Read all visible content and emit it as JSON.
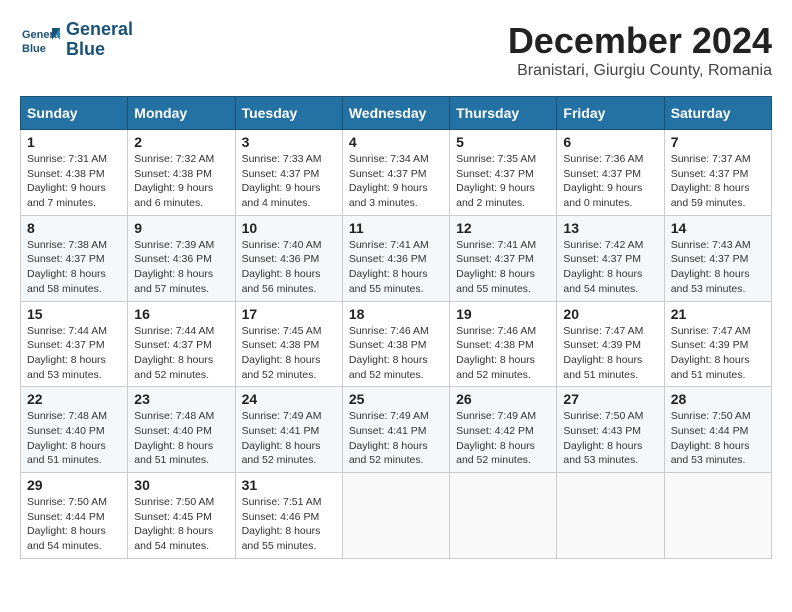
{
  "header": {
    "logo_line1": "General",
    "logo_line2": "Blue",
    "title": "December 2024",
    "subtitle": "Branistari, Giurgiu County, Romania"
  },
  "calendar": {
    "headers": [
      "Sunday",
      "Monday",
      "Tuesday",
      "Wednesday",
      "Thursday",
      "Friday",
      "Saturday"
    ],
    "weeks": [
      [
        {
          "day": "1",
          "info": "Sunrise: 7:31 AM\nSunset: 4:38 PM\nDaylight: 9 hours\nand 7 minutes."
        },
        {
          "day": "2",
          "info": "Sunrise: 7:32 AM\nSunset: 4:38 PM\nDaylight: 9 hours\nand 6 minutes."
        },
        {
          "day": "3",
          "info": "Sunrise: 7:33 AM\nSunset: 4:37 PM\nDaylight: 9 hours\nand 4 minutes."
        },
        {
          "day": "4",
          "info": "Sunrise: 7:34 AM\nSunset: 4:37 PM\nDaylight: 9 hours\nand 3 minutes."
        },
        {
          "day": "5",
          "info": "Sunrise: 7:35 AM\nSunset: 4:37 PM\nDaylight: 9 hours\nand 2 minutes."
        },
        {
          "day": "6",
          "info": "Sunrise: 7:36 AM\nSunset: 4:37 PM\nDaylight: 9 hours\nand 0 minutes."
        },
        {
          "day": "7",
          "info": "Sunrise: 7:37 AM\nSunset: 4:37 PM\nDaylight: 8 hours\nand 59 minutes."
        }
      ],
      [
        {
          "day": "8",
          "info": "Sunrise: 7:38 AM\nSunset: 4:37 PM\nDaylight: 8 hours\nand 58 minutes."
        },
        {
          "day": "9",
          "info": "Sunrise: 7:39 AM\nSunset: 4:36 PM\nDaylight: 8 hours\nand 57 minutes."
        },
        {
          "day": "10",
          "info": "Sunrise: 7:40 AM\nSunset: 4:36 PM\nDaylight: 8 hours\nand 56 minutes."
        },
        {
          "day": "11",
          "info": "Sunrise: 7:41 AM\nSunset: 4:36 PM\nDaylight: 8 hours\nand 55 minutes."
        },
        {
          "day": "12",
          "info": "Sunrise: 7:41 AM\nSunset: 4:37 PM\nDaylight: 8 hours\nand 55 minutes."
        },
        {
          "day": "13",
          "info": "Sunrise: 7:42 AM\nSunset: 4:37 PM\nDaylight: 8 hours\nand 54 minutes."
        },
        {
          "day": "14",
          "info": "Sunrise: 7:43 AM\nSunset: 4:37 PM\nDaylight: 8 hours\nand 53 minutes."
        }
      ],
      [
        {
          "day": "15",
          "info": "Sunrise: 7:44 AM\nSunset: 4:37 PM\nDaylight: 8 hours\nand 53 minutes."
        },
        {
          "day": "16",
          "info": "Sunrise: 7:44 AM\nSunset: 4:37 PM\nDaylight: 8 hours\nand 52 minutes."
        },
        {
          "day": "17",
          "info": "Sunrise: 7:45 AM\nSunset: 4:38 PM\nDaylight: 8 hours\nand 52 minutes."
        },
        {
          "day": "18",
          "info": "Sunrise: 7:46 AM\nSunset: 4:38 PM\nDaylight: 8 hours\nand 52 minutes."
        },
        {
          "day": "19",
          "info": "Sunrise: 7:46 AM\nSunset: 4:38 PM\nDaylight: 8 hours\nand 52 minutes."
        },
        {
          "day": "20",
          "info": "Sunrise: 7:47 AM\nSunset: 4:39 PM\nDaylight: 8 hours\nand 51 minutes."
        },
        {
          "day": "21",
          "info": "Sunrise: 7:47 AM\nSunset: 4:39 PM\nDaylight: 8 hours\nand 51 minutes."
        }
      ],
      [
        {
          "day": "22",
          "info": "Sunrise: 7:48 AM\nSunset: 4:40 PM\nDaylight: 8 hours\nand 51 minutes."
        },
        {
          "day": "23",
          "info": "Sunrise: 7:48 AM\nSunset: 4:40 PM\nDaylight: 8 hours\nand 51 minutes."
        },
        {
          "day": "24",
          "info": "Sunrise: 7:49 AM\nSunset: 4:41 PM\nDaylight: 8 hours\nand 52 minutes."
        },
        {
          "day": "25",
          "info": "Sunrise: 7:49 AM\nSunset: 4:41 PM\nDaylight: 8 hours\nand 52 minutes."
        },
        {
          "day": "26",
          "info": "Sunrise: 7:49 AM\nSunset: 4:42 PM\nDaylight: 8 hours\nand 52 minutes."
        },
        {
          "day": "27",
          "info": "Sunrise: 7:50 AM\nSunset: 4:43 PM\nDaylight: 8 hours\nand 53 minutes."
        },
        {
          "day": "28",
          "info": "Sunrise: 7:50 AM\nSunset: 4:44 PM\nDaylight: 8 hours\nand 53 minutes."
        }
      ],
      [
        {
          "day": "29",
          "info": "Sunrise: 7:50 AM\nSunset: 4:44 PM\nDaylight: 8 hours\nand 54 minutes."
        },
        {
          "day": "30",
          "info": "Sunrise: 7:50 AM\nSunset: 4:45 PM\nDaylight: 8 hours\nand 54 minutes."
        },
        {
          "day": "31",
          "info": "Sunrise: 7:51 AM\nSunset: 4:46 PM\nDaylight: 8 hours\nand 55 minutes."
        },
        {
          "day": "",
          "info": ""
        },
        {
          "day": "",
          "info": ""
        },
        {
          "day": "",
          "info": ""
        },
        {
          "day": "",
          "info": ""
        }
      ]
    ]
  }
}
